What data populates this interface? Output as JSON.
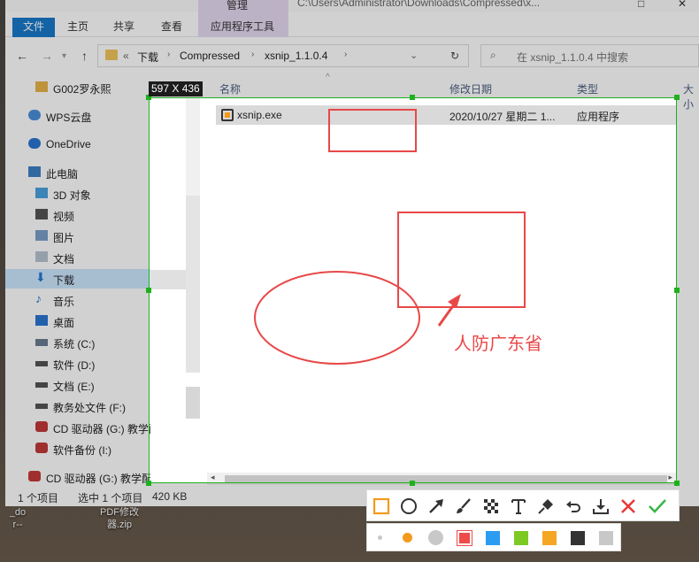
{
  "window": {
    "path_title": "C:\\Users\\Administrator\\Downloads\\Compressed\\x...",
    "tabs": {
      "file": "文件",
      "home": "主页",
      "share": "共享",
      "view": "查看",
      "manage_group": "管理",
      "app_tools": "应用程序工具"
    }
  },
  "address": {
    "prefix": "«",
    "crumbs": [
      "下载",
      "Compressed",
      "xsnip_1.1.0.4"
    ],
    "search_placeholder": "在 xsnip_1.1.0.4 中搜索"
  },
  "sidebar": {
    "items": [
      {
        "label": "G002罗永熙",
        "icon": "folder-icon"
      },
      {
        "label": "WPS云盘",
        "icon": "cloud-icon"
      },
      {
        "label": "OneDrive",
        "icon": "cloud-icon"
      },
      {
        "label": "此电脑",
        "icon": "computer-icon"
      },
      {
        "label": "3D 对象",
        "icon": "cube-icon"
      },
      {
        "label": "视频",
        "icon": "video-icon"
      },
      {
        "label": "图片",
        "icon": "picture-icon"
      },
      {
        "label": "文档",
        "icon": "document-icon"
      },
      {
        "label": "下载",
        "icon": "download-icon"
      },
      {
        "label": "音乐",
        "icon": "music-icon"
      },
      {
        "label": "桌面",
        "icon": "desktop-icon"
      },
      {
        "label": "系统 (C:)",
        "icon": "drive-icon"
      },
      {
        "label": "软件 (D:)",
        "icon": "drive-icon"
      },
      {
        "label": "文档 (E:)",
        "icon": "drive-icon"
      },
      {
        "label": "教务处文件 (F:)",
        "icon": "drive-icon"
      },
      {
        "label": "CD 驱动器 (G:) 教学配",
        "icon": "cd-icon"
      },
      {
        "label": "软件备份 (I:)",
        "icon": "drive-icon"
      },
      {
        "label": "CD 驱动器 (G:) 教学配套盘",
        "icon": "cd-icon"
      }
    ]
  },
  "columns": {
    "name": "名称",
    "modified": "修改日期",
    "type": "类型",
    "size": "大小"
  },
  "files": [
    {
      "name": "xsnip.exe",
      "modified": "2020/10/27 星期二 1...",
      "type": "应用程序"
    }
  ],
  "status": {
    "count": "1 个项目",
    "selected": "选中 1 个项目",
    "size": "420 KB"
  },
  "snip": {
    "size_label": "597 X 436",
    "annotation_text": "人防广东省"
  },
  "toolbar": {
    "tools": [
      "rectangle-icon",
      "ellipse-icon",
      "arrow-icon",
      "brush-icon",
      "mosaic-icon",
      "text-icon",
      "pin-icon",
      "undo-icon",
      "download-icon",
      "cancel-icon",
      "confirm-icon"
    ],
    "colors": {
      "accent": "#f39a1d",
      "annotation": "#e84848",
      "swatches": [
        "#f04b4b",
        "#2b9cf2",
        "#7cc924",
        "#f5a623",
        "#333333",
        "#c8c8c8"
      ]
    }
  },
  "desktop": {
    "labels": [
      "_do",
      "r--",
      "PDF修改",
      "器.zip"
    ]
  }
}
